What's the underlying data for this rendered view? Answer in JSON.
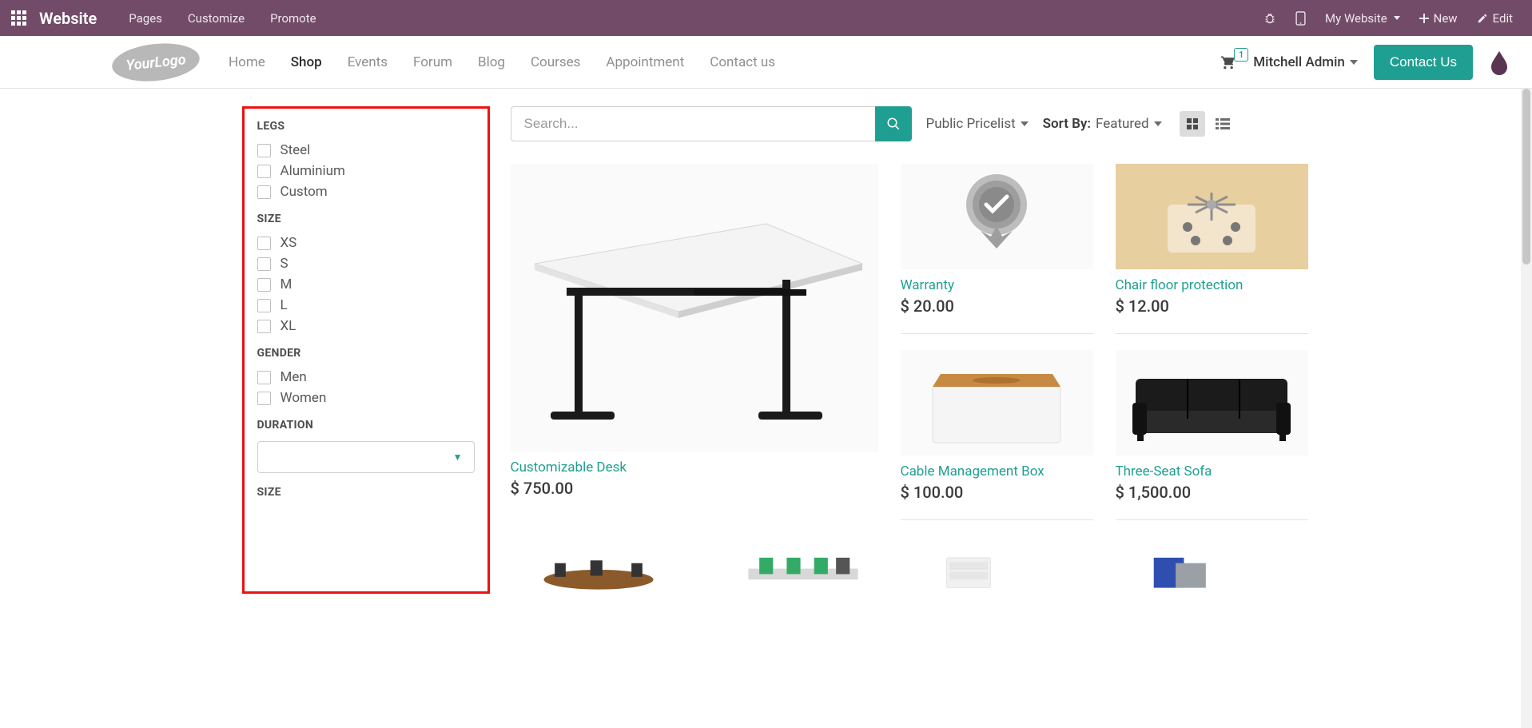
{
  "topbar": {
    "brand": "Website",
    "items": [
      "Pages",
      "Customize",
      "Promote"
    ],
    "website_link": "My Website",
    "new_label": "New",
    "edit_label": "Edit"
  },
  "header": {
    "logo_text": "YourLogo",
    "nav": [
      "Home",
      "Shop",
      "Events",
      "Forum",
      "Blog",
      "Courses",
      "Appointment",
      "Contact us"
    ],
    "active_nav": "Shop",
    "cart_count": "1",
    "user": "Mitchell Admin",
    "contact_btn": "Contact Us"
  },
  "filters": {
    "groups": [
      {
        "title": "LEGS",
        "options": [
          "Steel",
          "Aluminium",
          "Custom"
        ]
      },
      {
        "title": "SIZE",
        "options": [
          "XS",
          "S",
          "M",
          "L",
          "XL"
        ]
      },
      {
        "title": "GENDER",
        "options": [
          "Men",
          "Women"
        ]
      }
    ],
    "select_groups": [
      {
        "title": "DURATION"
      }
    ],
    "trailing_title": "SIZE"
  },
  "toolbar": {
    "search_placeholder": "Search...",
    "pricelist": "Public Pricelist",
    "sort_label": "Sort By:",
    "sort_value": "Featured"
  },
  "products": {
    "feature": {
      "name": "Customizable Desk",
      "price": "$ 750.00"
    },
    "col1": [
      {
        "name": "Warranty",
        "price": "$ 20.00"
      },
      {
        "name": "Cable Management Box",
        "price": "$ 100.00"
      }
    ],
    "col2": [
      {
        "name": "Chair floor protection",
        "price": "$ 12.00"
      },
      {
        "name": "Three-Seat Sofa",
        "price": "$ 1,500.00"
      }
    ]
  }
}
